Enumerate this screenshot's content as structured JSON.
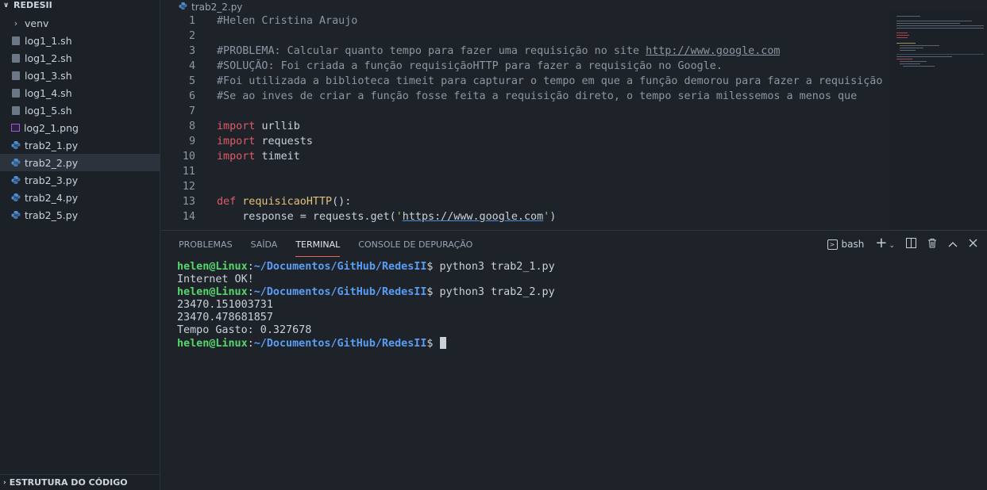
{
  "sidebar": {
    "title": "REDESII",
    "items": [
      {
        "label": "venv",
        "type": "folder"
      },
      {
        "label": "log1_1.sh",
        "type": "sh"
      },
      {
        "label": "log1_2.sh",
        "type": "sh"
      },
      {
        "label": "log1_3.sh",
        "type": "sh"
      },
      {
        "label": "log1_4.sh",
        "type": "sh"
      },
      {
        "label": "log1_5.sh",
        "type": "sh"
      },
      {
        "label": "log2_1.png",
        "type": "png"
      },
      {
        "label": "trab2_1.py",
        "type": "py"
      },
      {
        "label": "trab2_2.py",
        "type": "py",
        "active": true
      },
      {
        "label": "trab2_3.py",
        "type": "py"
      },
      {
        "label": "trab2_4.py",
        "type": "py"
      },
      {
        "label": "trab2_5.py",
        "type": "py"
      }
    ],
    "footer": "ESTRUTURA DO CÓDIGO"
  },
  "editor": {
    "tab": "trab2_2.py",
    "line_numbers": [
      "1",
      "2",
      "3",
      "4",
      "5",
      "6",
      "7",
      "8",
      "9",
      "10",
      "11",
      "12",
      "13",
      "14"
    ],
    "lines": {
      "l0": "#Helen Cristina Araujo",
      "l2_prefix": "#PROBLEMA: Calcular quanto tempo para fazer uma requisição no site ",
      "l2_url": "http://www.google.com",
      "l3": "#SOLUÇÃO: Foi criada a função requisiçãoHTTP para fazer a requisição no Google.",
      "l4": "#Foi utilizada a biblioteca timeit para capturar o tempo em que a função demorou para fazer a requisição",
      "l5": "#Se ao inves de criar a função fosse feita a requisição direto, o tempo seria milessemos a menos que",
      "import_kw": "import",
      "mod1": "urllib",
      "mod2": "requests",
      "mod3": "timeit",
      "def_kw": "def",
      "fn_name": "requisicaoHTTP",
      "fn_tail": "():",
      "l13_a": "    response = requests.get(",
      "l13_q1": "'",
      "l13_url": "https://www.google.com",
      "l13_q2": "'",
      "l13_b": ")"
    }
  },
  "panel": {
    "tabs": [
      "PROBLEMAS",
      "SAÍDA",
      "TERMINAL",
      "CONSOLE DE DEPURAÇÃO"
    ],
    "active_tab": "TERMINAL",
    "shell": "bash",
    "terminal": {
      "user": "helen@Linux",
      "path": "~/Documentos/GitHub/RedesII",
      "cmd1": " python3 trab2_1.py",
      "out1": "Internet OK!",
      "cmd2": " python3 trab2_2.py",
      "out2": "23470.151003731",
      "out3": "23470.478681857",
      "out4": "Tempo Gasto: 0.327678"
    }
  }
}
